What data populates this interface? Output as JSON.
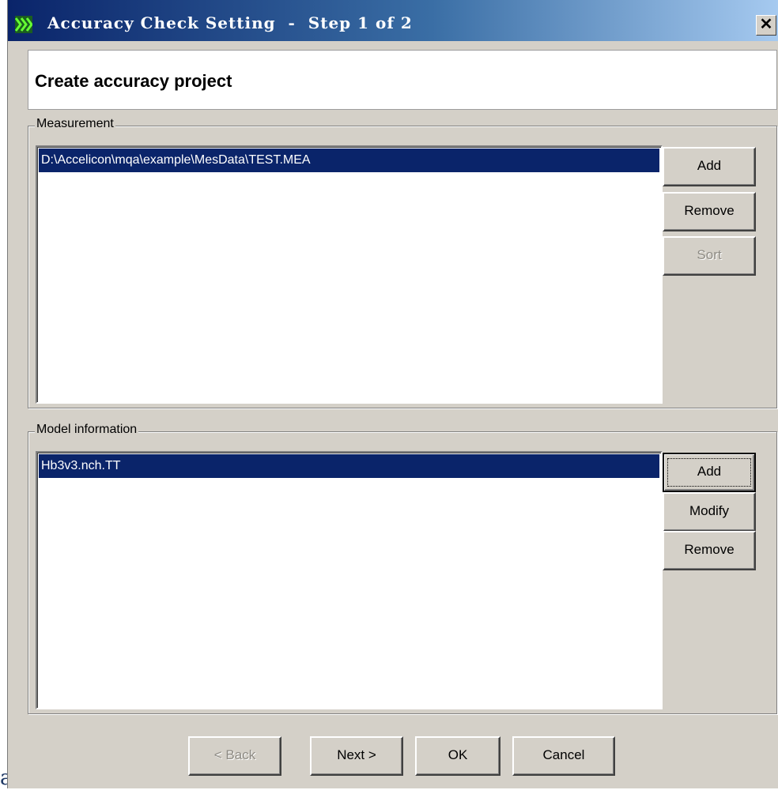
{
  "window": {
    "title": "Accuracy Check Setting  -  Step 1 of 2",
    "close_glyph": "✕"
  },
  "header": {
    "title": "Create accuracy project"
  },
  "measurement": {
    "label": "Measurement",
    "items": [
      "D:\\Accelicon\\mqa\\example\\MesData\\TEST.MEA"
    ],
    "buttons": {
      "add": "Add",
      "remove": "Remove",
      "sort": "Sort"
    }
  },
  "model": {
    "label": "Model information",
    "items": [
      "Hb3v3.nch.TT"
    ],
    "buttons": {
      "add": "Add",
      "modify": "Modify",
      "remove": "Remove"
    }
  },
  "footer": {
    "back": "< Back",
    "next": "Next >",
    "ok": "OK",
    "cancel": "Cancel"
  },
  "stray_text": "al",
  "colors": {
    "selection": "#0a246a",
    "face": "#d4d0c8"
  }
}
